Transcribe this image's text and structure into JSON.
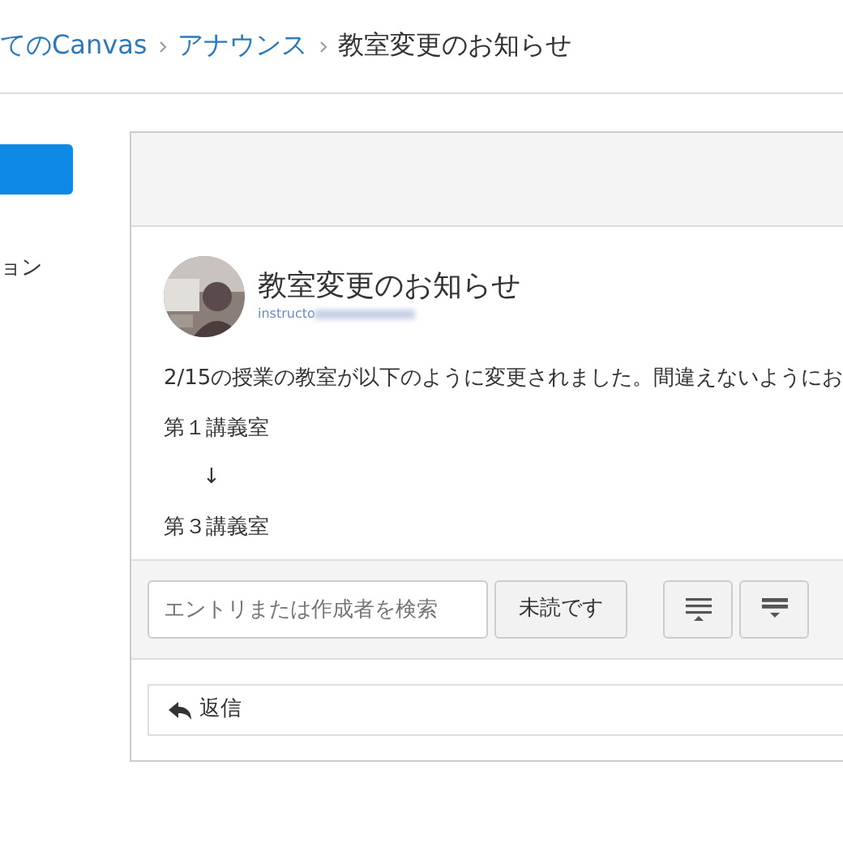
{
  "breadcrumb": [
    {
      "label": "てのCanvas",
      "link": true
    },
    {
      "label": "アナウンス",
      "link": true
    },
    {
      "label": "教室変更のお知らせ",
      "link": false
    }
  ],
  "sidebar": {
    "button": {
      "kind": "primary"
    },
    "items": [
      "ョン"
    ]
  },
  "announcement": {
    "title": "教室変更のお知らせ",
    "author": "instructo",
    "author_redacted": true,
    "body": [
      "2/15の授業の教室が以下のように変更されました。間違えないようにお",
      "第１講義室",
      "↓",
      "第３講義室"
    ]
  },
  "toolbar": {
    "search": {
      "placeholder": "エントリまたは作成者を検索"
    },
    "unread_button": "未読です",
    "icon_buttons": [
      {
        "kind": "expand"
      },
      {
        "kind": "collapse"
      }
    ]
  },
  "reply": {
    "label": "返信"
  }
}
